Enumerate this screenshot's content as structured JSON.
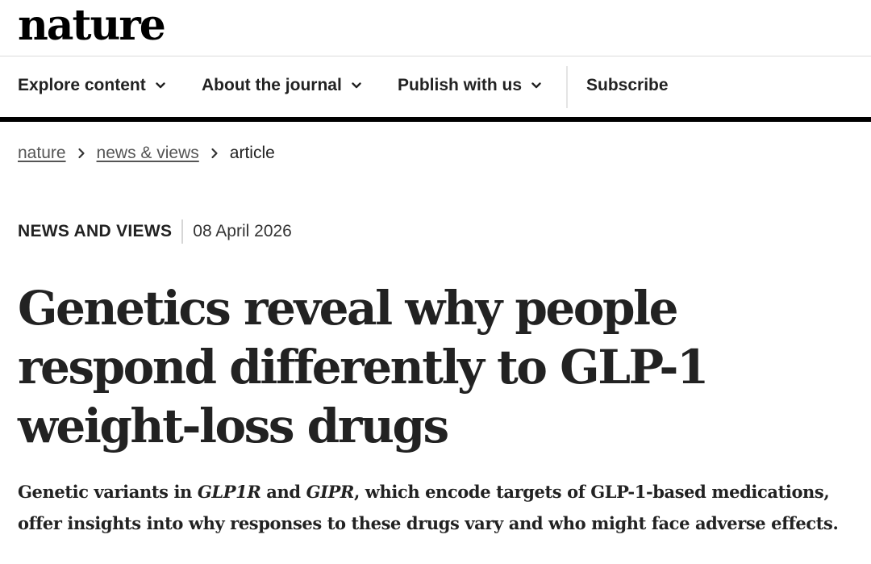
{
  "site": {
    "logo_text": "nature"
  },
  "nav": {
    "items": [
      {
        "label": "Explore content",
        "has_dropdown": true
      },
      {
        "label": "About the journal",
        "has_dropdown": true
      },
      {
        "label": "Publish with us",
        "has_dropdown": true
      },
      {
        "label": "Subscribe",
        "has_dropdown": false
      }
    ]
  },
  "breadcrumb": {
    "items": [
      {
        "label": "nature",
        "link": true
      },
      {
        "label": "news & views",
        "link": true
      },
      {
        "label": "article",
        "link": false
      }
    ]
  },
  "article": {
    "type": "NEWS AND VIEWS",
    "date": "08 April 2026",
    "title": "Genetics reveal why people respond differently to GLP-1 weight-loss drugs",
    "standfirst": {
      "part1": "Genetic variants in ",
      "gene1": "GLP1R",
      "part2": " and ",
      "gene2": "GIPR",
      "part3": ", which encode targets of GLP-1-based medications, offer insights into why responses to these drugs vary and who might face adverse effects."
    }
  },
  "icons": {
    "dropdown": "chevron-down-icon",
    "breadcrumb_separator": "chevron-right-icon"
  },
  "colors": {
    "text": "#222222",
    "breadcrumb_link": "#555555",
    "rule": "#000000"
  }
}
